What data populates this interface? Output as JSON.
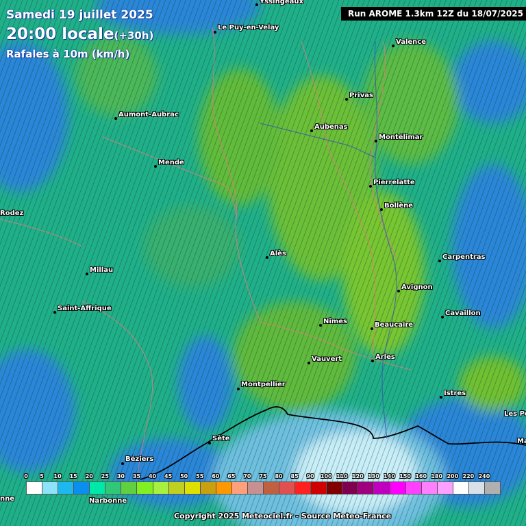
{
  "header": {
    "date": "Samedi 19 juillet 2025",
    "time": "20:00 locale",
    "lead": "(+30h)",
    "parameter": "Rafales à 10m (km/h)",
    "run": "Run AROME 1.3km 12Z du 18/07/2025"
  },
  "cities": {
    "yssingeaux": "Yssingeaux",
    "le_puy": "Le Puy-en-Velay",
    "valence": "Valence",
    "privas": "Privas",
    "aumont_aubrac": "Aumont-Aubrac",
    "aubenas": "Aubenas",
    "montelimar": "Montélimar",
    "mende": "Mende",
    "pierrelatte": "Pierrelatte",
    "bollene": "Bollène",
    "rodez": "Rodez",
    "carpentras": "Carpentras",
    "ales": "Alès",
    "millau": "Millau",
    "avignon": "Avignon",
    "saint_affrique": "Saint-Affrique",
    "cavaillon": "Cavaillon",
    "nimes": "Nîmes",
    "beaucaire": "Beaucaire",
    "vauvert": "Vauvert",
    "arles": "Arles",
    "montpellier": "Montpellier",
    "istres": "Istres",
    "les_pennes": "Les Pe",
    "ma": "Ma",
    "sete": "Sète",
    "beziers": "Béziers",
    "narbonne": "Narbonne",
    "nne": "nne"
  },
  "legend": {
    "unit": "km/h",
    "thresholds": [
      "0",
      "5",
      "10",
      "15",
      "20",
      "25",
      "30",
      "35",
      "40",
      "45",
      "50",
      "55",
      "60",
      "65",
      "70",
      "75",
      "80",
      "85",
      "90",
      "100",
      "110",
      "120",
      "130",
      "140",
      "150",
      "160",
      "180",
      "200",
      "220",
      "240"
    ],
    "colors": [
      "#ffffff",
      "#8fe3f8",
      "#1fb8ee",
      "#0a8ff0",
      "#00e8a8",
      "#30c878",
      "#60d040",
      "#80f020",
      "#a8f040",
      "#c0d020",
      "#e0e000",
      "#c8a010",
      "#ff9800",
      "#ffa07a",
      "#c89090",
      "#c06040",
      "#e05050",
      "#ff2020",
      "#d00000",
      "#800000",
      "#800050",
      "#a00080",
      "#c000c0",
      "#ff00ff",
      "#ff40ff",
      "#ff80ff",
      "#ffa0ff",
      "#ffffff",
      "#d8e0e8",
      "#b0b0b0"
    ]
  },
  "map_colors": {
    "calm": "#2a7fd8",
    "moderate": "#20c090",
    "strong": "#70c030",
    "sea_calm": "#8fd0e8"
  },
  "copyright": "Copyright 2025 Meteociel.fr - Source Meteo-France"
}
